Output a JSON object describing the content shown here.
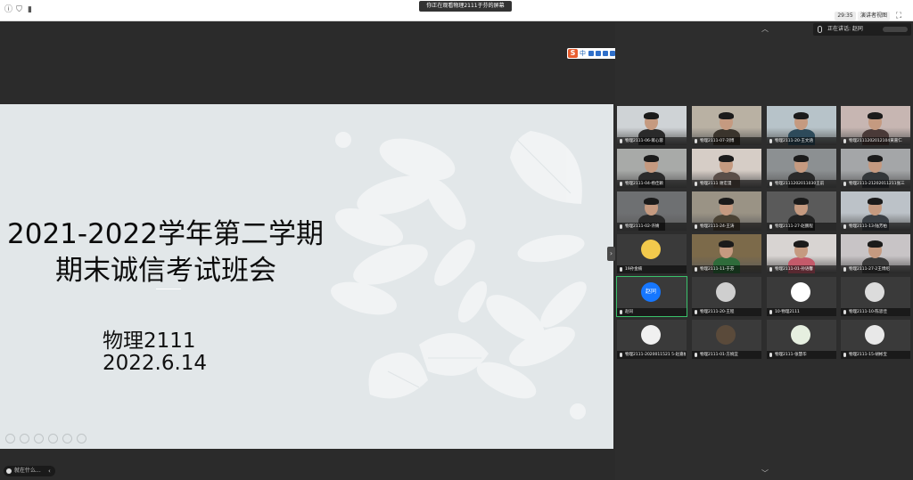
{
  "titlebar": {
    "share_notice": "你正在观看物理2111于芬的屏幕",
    "time": "29:35",
    "speaker_view_label": "演讲者视图",
    "fullscreen_icon": "fullscreen-icon"
  },
  "slide": {
    "title_line1": "2021-2022学年第二学期",
    "title_line2": "期末诚信考试班会",
    "class_name": "物理2111",
    "date": "2022.6.14"
  },
  "ime": {
    "logo": "S",
    "mode": "中"
  },
  "status_chip": {
    "label": "就在什么..."
  },
  "panel": {
    "speaking_label": "正在讲话: 赵同",
    "participants": [
      {
        "name": "物理2111-06-蒋心蓉",
        "kind": "video"
      },
      {
        "name": "物理2111-07-刘博",
        "kind": "video"
      },
      {
        "name": "物理2111-20-王文涵",
        "kind": "video"
      },
      {
        "name": "物理2111202012104黄嘉仁",
        "kind": "video"
      },
      {
        "name": "物理2111-04-杨佳颖",
        "kind": "video"
      },
      {
        "name": "物理2111 谢宏漫",
        "kind": "video"
      },
      {
        "name": "物理2111202011030王前",
        "kind": "video"
      },
      {
        "name": "物理2111-21202011211张三",
        "kind": "video"
      },
      {
        "name": "物理2111-02-许婧",
        "kind": "video"
      },
      {
        "name": "物理2111-24-王涛",
        "kind": "video"
      },
      {
        "name": "物理2111-27-赵鹏程",
        "kind": "video"
      },
      {
        "name": "物理2111-13-陆芳柏",
        "kind": "video"
      },
      {
        "name": "19孙金楠",
        "kind": "avatar"
      },
      {
        "name": "物理2111-11-于芬",
        "kind": "video"
      },
      {
        "name": "物理2111-01-孙语馨",
        "kind": "video"
      },
      {
        "name": "物理2111-27-2王博绍",
        "kind": "video"
      },
      {
        "name": "赵同",
        "kind": "text-avatar",
        "avatar_text": "赵同"
      },
      {
        "name": "物理2111-20-王程",
        "kind": "avatar"
      },
      {
        "name": "10-物理2111",
        "kind": "avatar"
      },
      {
        "name": "物理2111-10-陈思佳",
        "kind": "avatar"
      },
      {
        "name": "物理2111-2020011521 5-赵嘉帆",
        "kind": "avatar"
      },
      {
        "name": "物理2111-01-方婉宜",
        "kind": "avatar"
      },
      {
        "name": "物理2111-张慧华",
        "kind": "avatar"
      },
      {
        "name": "物理2111-15-胡彬宝",
        "kind": "avatar"
      }
    ]
  },
  "colors": {
    "slide_bg": "#e2e7e9",
    "panel_bg": "#2d2d2d",
    "speaking_outline": "#3ac26b",
    "avatar_blue": "#1677ff"
  }
}
